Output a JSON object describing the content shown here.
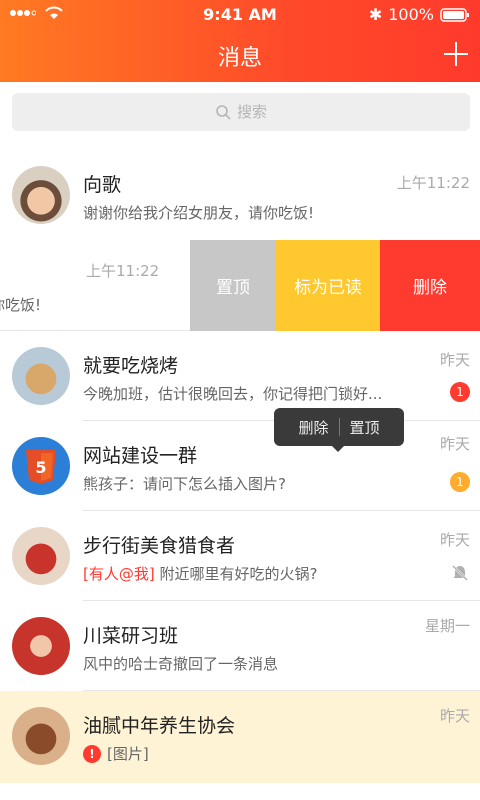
{
  "status_bar": {
    "time": "9:41 AM",
    "battery": "100%"
  },
  "header": {
    "title": "消息"
  },
  "search": {
    "placeholder": "搜索"
  },
  "swipe_row": {
    "time": "上午11:22",
    "preview_fragment": "你吃饭!",
    "actions": {
      "pin": "置顶",
      "mark_read": "标为已读",
      "delete": "删除"
    }
  },
  "tooltip": {
    "delete": "删除",
    "pin": "置顶"
  },
  "chats": [
    {
      "name": "向歌",
      "preview": "谢谢你给我介绍女朋友，请你吃饭!",
      "time": "上午11:22"
    },
    {
      "name": "就要吃烧烤",
      "preview": "今晚加班，估计很晚回去，你记得把门锁好...",
      "time": "昨天",
      "badge": "1",
      "badge_color": "#ff3a2f"
    },
    {
      "name": "网站建设一群",
      "preview": "熊孩子：请问下怎么插入图片?",
      "time": "昨天",
      "badge": "1",
      "badge_color": "#ffab2e"
    },
    {
      "name": "步行街美食猎食者",
      "mention": "[有人@我]",
      "preview": "附近哪里有好吃的火锅?",
      "time": "昨天"
    },
    {
      "name": "川菜研习班",
      "preview": "风中的哈士奇撤回了一条消息",
      "time": "星期一"
    },
    {
      "name": "油腻中年养生协会",
      "preview": "[图片]",
      "time": "昨天"
    }
  ]
}
